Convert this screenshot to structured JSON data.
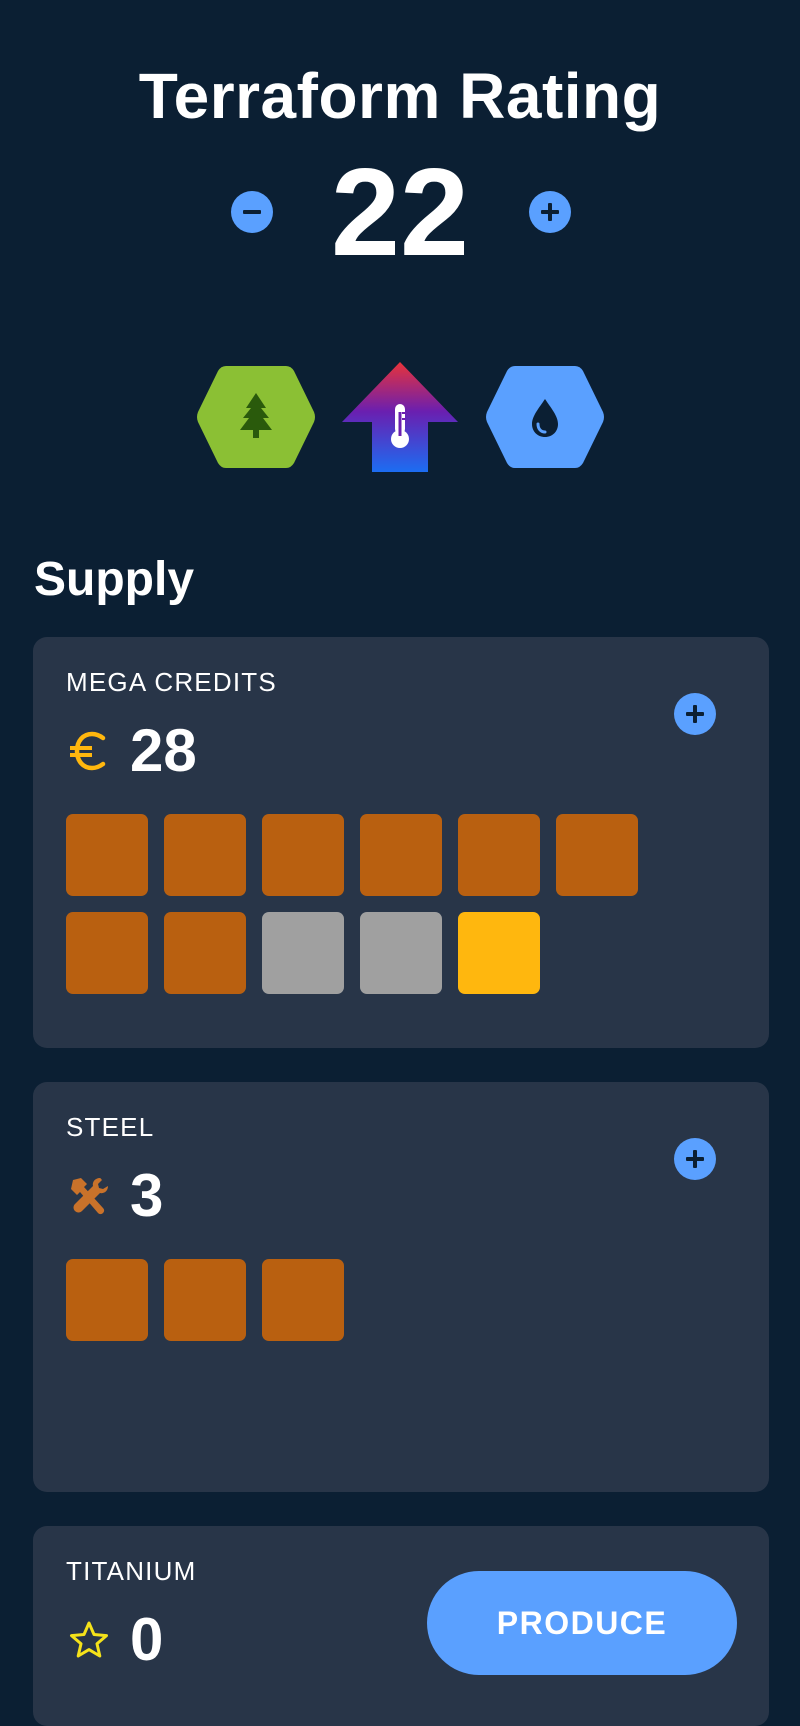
{
  "terraform": {
    "title": "Terraform Rating",
    "value": "22"
  },
  "parameters": [
    {
      "name": "oxygen",
      "icon": "tree-icon",
      "color": "#8bc034"
    },
    {
      "name": "temperature",
      "icon": "thermometer-icon",
      "colors": [
        "#e8333a",
        "#6a1fb0",
        "#1c6df2"
      ]
    },
    {
      "name": "ocean",
      "icon": "water-drop-icon",
      "color": "#5aa0ff"
    }
  ],
  "supply": {
    "heading": "Supply",
    "mega_credits": {
      "label": "MEGA CREDITS",
      "icon": "euro-icon",
      "value": "28",
      "cubes": [
        "bronze",
        "bronze",
        "bronze",
        "bronze",
        "bronze",
        "bronze",
        "bronze",
        "bronze",
        "silver",
        "silver",
        "gold"
      ]
    },
    "steel": {
      "label": "STEEL",
      "icon": "tools-icon",
      "value": "3",
      "cubes": [
        "bronze",
        "bronze",
        "bronze"
      ]
    },
    "titanium": {
      "label": "TITANIUM",
      "icon": "star-icon",
      "value": "0",
      "produce_label": "PRODUCE"
    }
  },
  "colors": {
    "background": "#0b1f33",
    "card": "#283548",
    "accent": "#5aa0ff",
    "bronze": "#b96010",
    "silver": "#a0a0a0",
    "gold": "#ffb70e"
  }
}
